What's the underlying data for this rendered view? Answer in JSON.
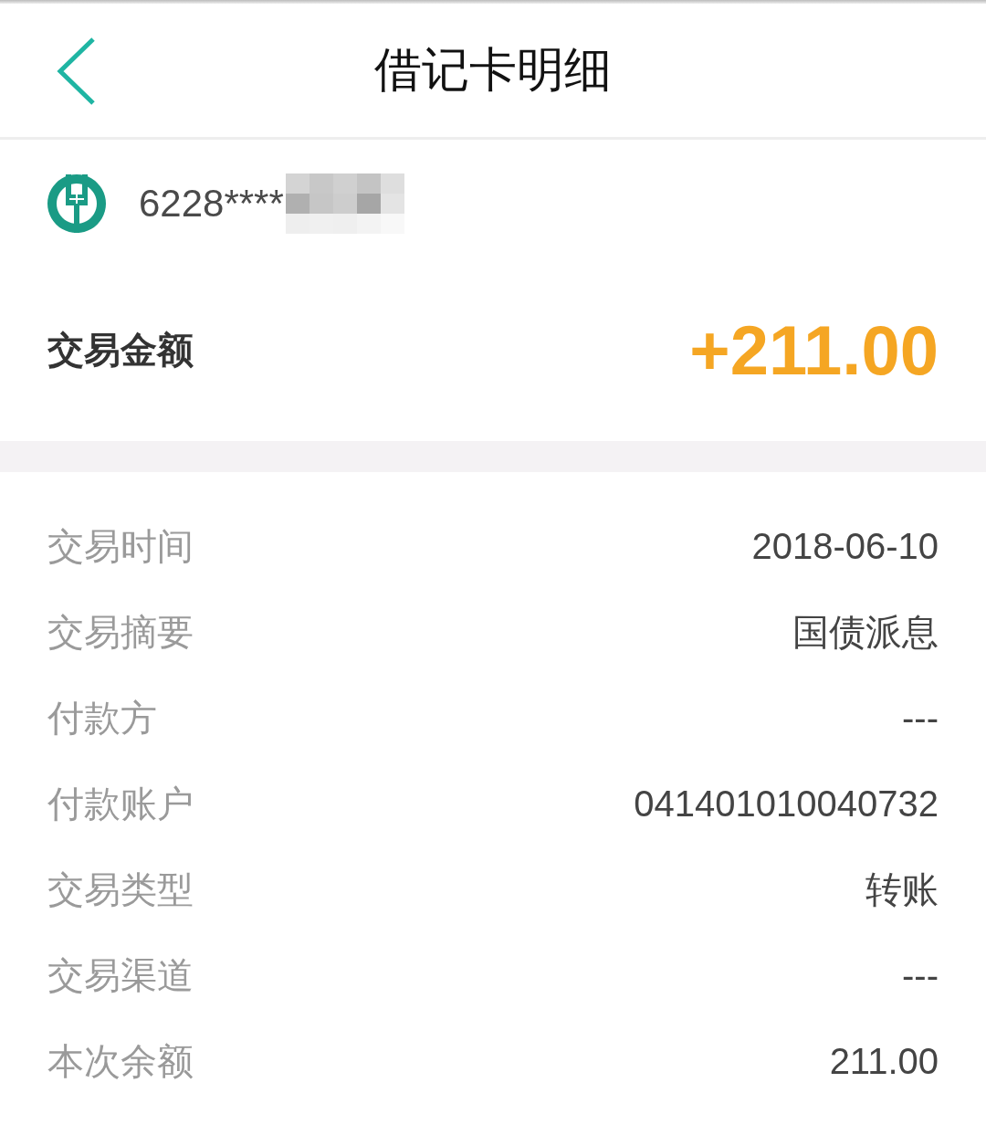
{
  "header": {
    "title": "借记卡明细"
  },
  "card": {
    "number": "6228****"
  },
  "amount": {
    "label": "交易金额",
    "value": "+211.00"
  },
  "details": [
    {
      "label": "交易时间",
      "value": "2018-06-10"
    },
    {
      "label": "交易摘要",
      "value": "国债派息"
    },
    {
      "label": "付款方",
      "value": "---"
    },
    {
      "label": "付款账户",
      "value": "041401010040732"
    },
    {
      "label": "交易类型",
      "value": "转账"
    },
    {
      "label": "交易渠道",
      "value": "---"
    },
    {
      "label": "本次余额",
      "value": "211.00"
    }
  ]
}
